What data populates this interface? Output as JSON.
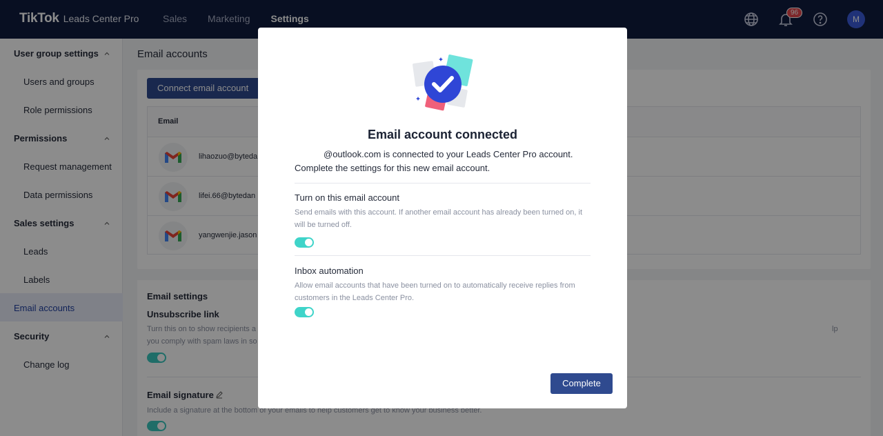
{
  "app": {
    "brand": "TikTok",
    "product": "Leads Center Pro"
  },
  "topnav": {
    "items": [
      {
        "label": "Sales"
      },
      {
        "label": "Marketing"
      },
      {
        "label": "Settings"
      }
    ],
    "notifications_count": "96",
    "avatar_initial": "M"
  },
  "sidebar": {
    "groups": [
      {
        "label": "User group settings",
        "items": [
          "Users and groups",
          "Role permissions"
        ]
      },
      {
        "label": "Permissions",
        "items": [
          "Request management",
          "Data permissions"
        ]
      },
      {
        "label": "Sales settings",
        "items": [
          "Leads",
          "Labels"
        ]
      },
      {
        "label": "Email accounts",
        "items": []
      },
      {
        "label": "Security",
        "items": [
          "Change log"
        ]
      }
    ],
    "active": "Email accounts"
  },
  "main": {
    "title": "Email accounts",
    "connect_button": "Connect email account",
    "table": {
      "header": "Email",
      "rows": [
        {
          "email": "lihaozuo@byteda"
        },
        {
          "email": "lifei.66@bytedan"
        },
        {
          "email": "yangwenjie.jason"
        }
      ]
    },
    "email_settings": {
      "title": "Email settings",
      "unsubscribe_title": "Unsubscribe link",
      "unsubscribe_desc_line1_left": "Turn this on to show recipients a",
      "unsubscribe_desc_line1_right": "lp",
      "unsubscribe_desc_line2": "you comply with spam laws in so",
      "signature_title": "Email signature",
      "signature_desc": "Include a signature at the bottom of your emails to help customers get to know your business better."
    }
  },
  "modal": {
    "title": "Email account connected",
    "desc_line1": "@outlook.com is connected to your Leads Center Pro account.",
    "desc_line2": "Complete the settings for this new email account.",
    "option1_title": "Turn on this email account",
    "option1_desc": "Send emails with this account. If another email account has already been turned on, it will be turned off.",
    "option1_on": true,
    "option2_title": "Inbox automation",
    "option2_desc": "Allow email accounts that have been turned on to automatically receive replies from customers in the Leads Center Pro.",
    "option2_on": true,
    "complete_button": "Complete"
  },
  "colors": {
    "header_bg": "#0f1c3f",
    "primary": "#2f4a8f",
    "toggle_on": "#3fd4c9",
    "badge": "#e5484d"
  }
}
